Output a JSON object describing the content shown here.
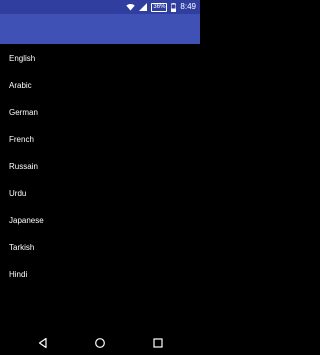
{
  "status_bar": {
    "battery_percent": "36%",
    "time": "8:49",
    "icons": [
      "wifi-icon",
      "signal-icon",
      "battery-icon"
    ]
  },
  "app_bar": {
    "color": "#3f51b5"
  },
  "languages": [
    {
      "label": "English"
    },
    {
      "label": "Arabic"
    },
    {
      "label": "German"
    },
    {
      "label": "French"
    },
    {
      "label": "Russain"
    },
    {
      "label": "Urdu"
    },
    {
      "label": "Japanese"
    },
    {
      "label": "Tarkish"
    },
    {
      "label": "Hindi"
    }
  ],
  "nav_bar": {
    "icons": [
      "back-icon",
      "home-icon",
      "recents-icon"
    ]
  }
}
